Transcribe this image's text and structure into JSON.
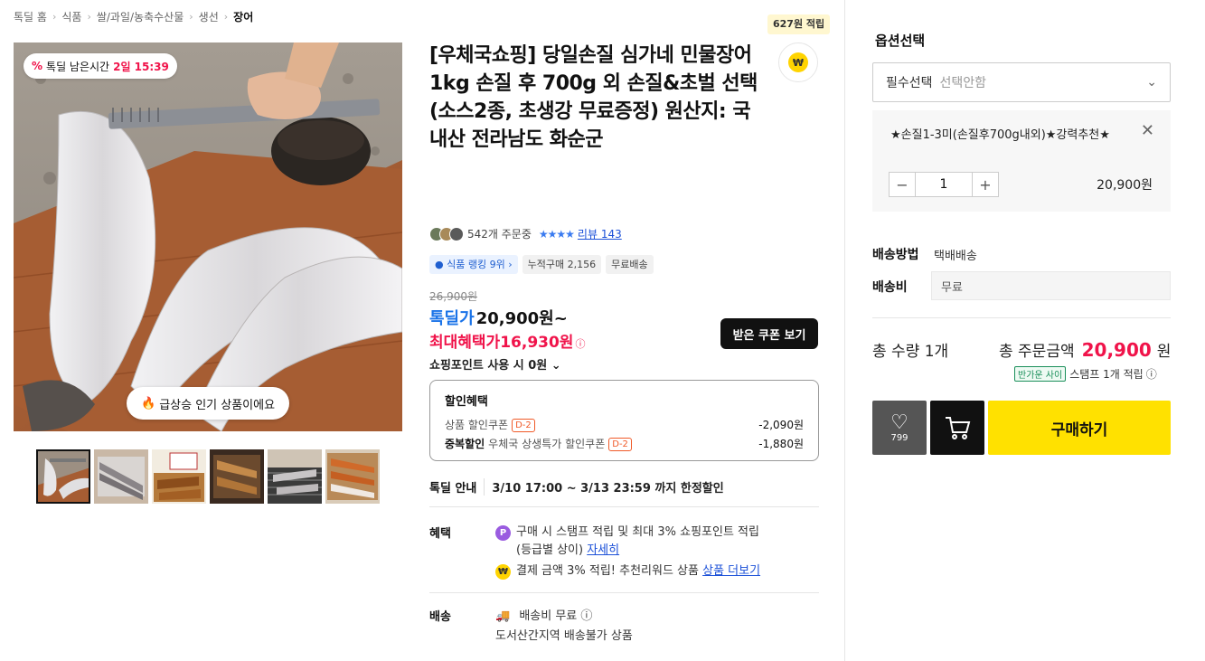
{
  "breadcrumb": [
    "톡딜 홈",
    "식품",
    "쌀/과일/농축수산물",
    "생선",
    "장어"
  ],
  "breadcrumb_sep": "›",
  "points_badge": "627원 적립",
  "pay_icon": "₩",
  "image": {
    "timer_icon": "%",
    "timer_label": "톡딜 남은시간",
    "timer_value": "2일 15:39",
    "hot_icon": "🔥",
    "hot_text": "급상승 인기 상품이에요"
  },
  "title": "[우체국쇼핑] 당일손질 심가네 민물장어 1kg 손질 후 700g 외 손질&초벌 선택(소스2종, 초생강 무료증정) 원산지: 국내산 전라남도 화순군",
  "rating": {
    "orders": "542개 주문중",
    "stars": "★★★★",
    "review": "리뷰 143"
  },
  "tags": {
    "ranking": "식품 랭킹 9위",
    "cumulative": "누적구매 2,156",
    "shipping": "무료배송"
  },
  "price": {
    "original": "26,900원",
    "deal_label": "톡딜가",
    "deal_value": "20,900원~",
    "max_label": "최대혜택가",
    "max_value": "16,930원",
    "info_icon": "ⓘ",
    "coupon_button": "받은 쿠폰 보기",
    "shop_points": "쇼핑포인트 사용 시 0원"
  },
  "discount": {
    "header": "할인혜택",
    "row1_label": "상품 할인쿠폰",
    "row1_dday": "D-2",
    "row1_amount": "-2,090원",
    "row2_bold": "중복할인",
    "row2_label": "우체국 상생특가 할인쿠폰",
    "row2_dday": "D-2",
    "row2_amount": "-1,880원"
  },
  "deal_info": {
    "label": "톡딜 안내",
    "value": "3/10 17:00 ~ 3/13 23:59 까지 한정할인"
  },
  "benefit": {
    "label": "혜택",
    "item1_icon": "P",
    "item1_text": "구매 시 스탬프 적립 및 최대 3% 쇼핑포인트 적립",
    "item1_sub": "(등급별 상이)",
    "item1_link": "자세히",
    "item2_icon": "₩",
    "item2_text": "결제 금액 3% 적립! 추천리워드 상품",
    "item2_link": "상품 더보기"
  },
  "shipping": {
    "label": "배송",
    "fee": "배송비 무료",
    "note": "도서산간지역 배송불가 상품"
  },
  "right": {
    "option_title": "옵션선택",
    "select_required": "필수선택",
    "select_placeholder": "선택안함",
    "option_name": "★손질1-3미(손질후700g내외)★강력추천★",
    "qty": "1",
    "option_price": "20,900원",
    "delivery_method_label": "배송방법",
    "delivery_method_value": "택배배송",
    "delivery_fee_label": "배송비",
    "delivery_fee_value": "무료",
    "total_qty": "총 수량 1개",
    "total_label": "총 주문금액",
    "total_value": "20,900",
    "total_unit": "원",
    "stamp_badge": "반가운 사이",
    "stamp_text": "스탬프 1개 적립",
    "like_count": "799",
    "buy_button": "구매하기"
  },
  "colors": {
    "accent_red": "#f0134a",
    "accent_blue": "#1a73e8",
    "buy_yellow": "#ffe100"
  }
}
